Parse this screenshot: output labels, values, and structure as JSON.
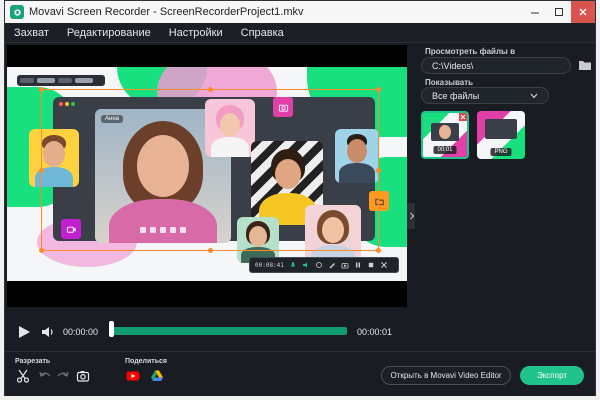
{
  "window": {
    "title": "Movavi Screen Recorder - ScreenRecorderProject1.mkv"
  },
  "menu": {
    "items": [
      "Захват",
      "Редактирование",
      "Настройки",
      "Справка"
    ]
  },
  "preview": {
    "participant_name": "Анна",
    "recording_time": "00:08:41"
  },
  "right_panel": {
    "view_files_label": "Просмотреть файлы в",
    "path": "C:\\Videos\\",
    "show_label": "Показывать",
    "filter_value": "Все файлы",
    "thumbnails": [
      {
        "label": "00:01",
        "selected": true
      },
      {
        "label": "PNG",
        "selected": false
      }
    ]
  },
  "playback": {
    "current_time": "00:00:00",
    "total_time": "00:00:01",
    "progress": 0.0
  },
  "bottom": {
    "cut_label": "Разрезать",
    "share_label": "Поделиться",
    "open_editor_label": "Открыть в Movavi Video Editor",
    "export_label": "Экспорт"
  },
  "colors": {
    "accent": "#1fc38b",
    "recording_frame": "#ff8a2a",
    "pink": "#e23ea8",
    "green": "#19e07e"
  },
  "icons": {
    "play": "play-icon",
    "volume": "speaker-icon",
    "cut": "scissors-icon",
    "undo": "undo-icon",
    "redo": "redo-icon",
    "snapshot": "camera-icon",
    "youtube": "youtube-icon",
    "drive": "google-drive-icon",
    "folder": "folder-icon"
  }
}
